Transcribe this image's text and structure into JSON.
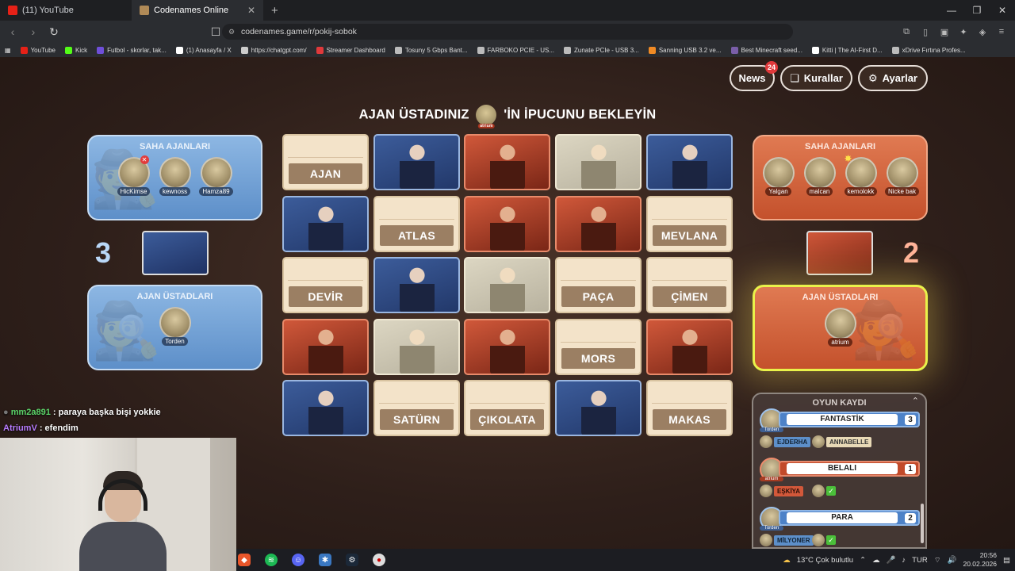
{
  "browser": {
    "tabs": [
      {
        "label": "(11) YouTube",
        "active": false,
        "color": "#e62117"
      },
      {
        "label": "Codenames Online",
        "active": true,
        "color": "#b08a57"
      }
    ],
    "url": "codenames.game/r/pokij-sobok",
    "bookmarks": [
      {
        "label": "YouTube",
        "color": "#e62117"
      },
      {
        "label": "Kick",
        "color": "#53fc18"
      },
      {
        "label": "Futbol - skorlar, tak...",
        "color": "#6f4fd9"
      },
      {
        "label": "(1) Anasayfa / X",
        "color": "#ffffff"
      },
      {
        "label": "https://chatgpt.com/",
        "color": "#cccccc"
      },
      {
        "label": "Streamer Dashboard",
        "color": "#e0393b"
      },
      {
        "label": "Tosuny 5 Gbps Bant...",
        "color": "#bbbbbb"
      },
      {
        "label": "FARBOKO PCIE - US...",
        "color": "#bbbbbb"
      },
      {
        "label": "Zunate PCIe - USB 3...",
        "color": "#bbbbbb"
      },
      {
        "label": "Sanning USB 3.2 ve...",
        "color": "#f08a24"
      },
      {
        "label": "Best Minecraft seed...",
        "color": "#7a5ea8"
      },
      {
        "label": "Kitti | The AI-First D...",
        "color": "#ffffff"
      },
      {
        "label": "xDrive Fırtına Profes...",
        "color": "#bbbbbb"
      }
    ]
  },
  "game": {
    "top_buttons": {
      "news": "News",
      "news_count": "24",
      "rules": "Kurallar",
      "settings": "Ayarlar"
    },
    "headline_before": "AJAN ÜSTADINIZ",
    "headline_after": "'İN İPUCUNU BEKLEYİN",
    "headline_avatar_tag": "atrium",
    "blue_team": {
      "operatives_title": "SAHA AJANLARI",
      "operatives": [
        "HicKimse",
        "kewnoss",
        "Hamza89"
      ],
      "spymasters_title": "AJAN ÜSTADLARI",
      "spymasters": [
        "Torden"
      ],
      "score": "3"
    },
    "red_team": {
      "operatives_title": "SAHA AJANLARI",
      "operatives": [
        "Yalgan",
        "malcan",
        "kemolokk",
        "Nicke bak"
      ],
      "spymasters_title": "AJAN ÜSTADLARI",
      "spymasters": [
        "atrium"
      ],
      "score": "2"
    },
    "board": [
      {
        "type": "word",
        "text": "AJAN"
      },
      {
        "type": "blue-agent",
        "text": ""
      },
      {
        "type": "red-agent",
        "text": ""
      },
      {
        "type": "neutral",
        "text": ""
      },
      {
        "type": "blue-agent",
        "text": ""
      },
      {
        "type": "blue-agent",
        "text": ""
      },
      {
        "type": "word",
        "text": "ATLAS"
      },
      {
        "type": "red-agent",
        "text": ""
      },
      {
        "type": "red-agent",
        "text": ""
      },
      {
        "type": "word",
        "text": "MEVLANA"
      },
      {
        "type": "word",
        "text": "DEVİR"
      },
      {
        "type": "blue-agent",
        "text": ""
      },
      {
        "type": "neutral",
        "text": ""
      },
      {
        "type": "word",
        "text": "PAÇA"
      },
      {
        "type": "word",
        "text": "ÇİMEN"
      },
      {
        "type": "red-agent",
        "text": ""
      },
      {
        "type": "neutral",
        "text": ""
      },
      {
        "type": "red-agent",
        "text": ""
      },
      {
        "type": "word",
        "text": "MORS"
      },
      {
        "type": "red-agent",
        "text": ""
      },
      {
        "type": "blue-agent",
        "text": ""
      },
      {
        "type": "word",
        "text": "SATÜRN"
      },
      {
        "type": "word",
        "text": "ÇIKOLATA"
      },
      {
        "type": "blue-agent",
        "text": ""
      },
      {
        "type": "word",
        "text": "MAKAS"
      }
    ],
    "log": {
      "title": "OYUN KAYDI",
      "entries": [
        {
          "team": "blue",
          "spymaster": "Torden",
          "clue": "FANTASTİK",
          "number": "3",
          "guesses": [
            {
              "word": "EJDERHA",
              "kind": "blue"
            },
            {
              "word": "ANNABELLE",
              "kind": "neutral"
            }
          ]
        },
        {
          "team": "red",
          "spymaster": "atrium",
          "clue": "BELALI",
          "number": "1",
          "guesses": [
            {
              "word": "EŞKİYA",
              "kind": "red"
            }
          ]
        },
        {
          "team": "blue",
          "spymaster": "Torden",
          "clue": "PARA",
          "number": "2",
          "guesses": [
            {
              "word": "MİLYONER",
              "kind": "blue"
            }
          ]
        }
      ]
    }
  },
  "chat": [
    {
      "user": "mm2a891",
      "message": " : paraya başka bişi yokkie"
    },
    {
      "user": "AtriumV",
      "message": " : efendim"
    }
  ],
  "taskbar": {
    "weather": "13°C  Çok bulutlu",
    "lang": "TUR",
    "time": "20:56",
    "date": "20.02.2026"
  }
}
